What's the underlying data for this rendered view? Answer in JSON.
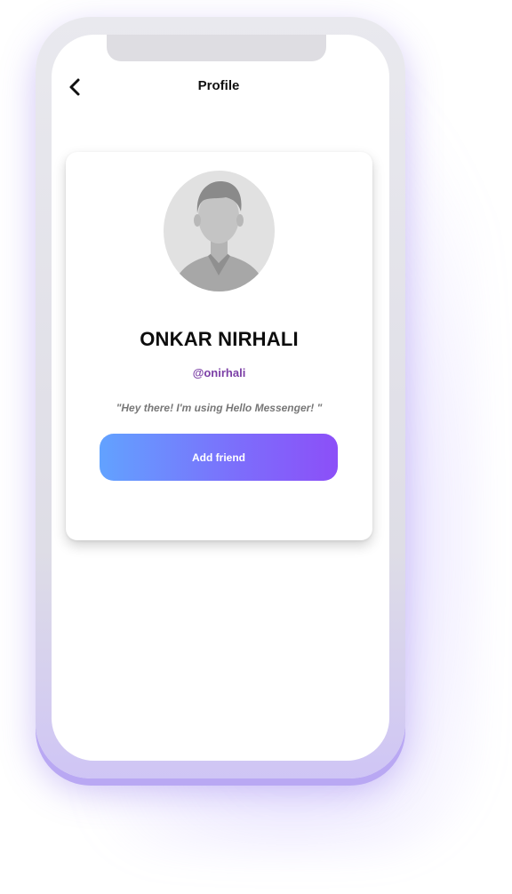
{
  "header": {
    "title": "Profile",
    "back_icon": "chevron-left-icon"
  },
  "profile": {
    "name": "ONKAR NIRHALI",
    "handle": "@onirhali",
    "status": "\"Hey there! I'm using Hello Messenger! \"",
    "avatar_icon": "default-user-avatar-icon"
  },
  "actions": {
    "add_friend_label": "Add friend"
  },
  "colors": {
    "handle": "#7b3fa6",
    "button_gradient_start": "#62a2ff",
    "button_gradient_end": "#8c4ff8",
    "phone_glow": "#b9a8f3"
  }
}
